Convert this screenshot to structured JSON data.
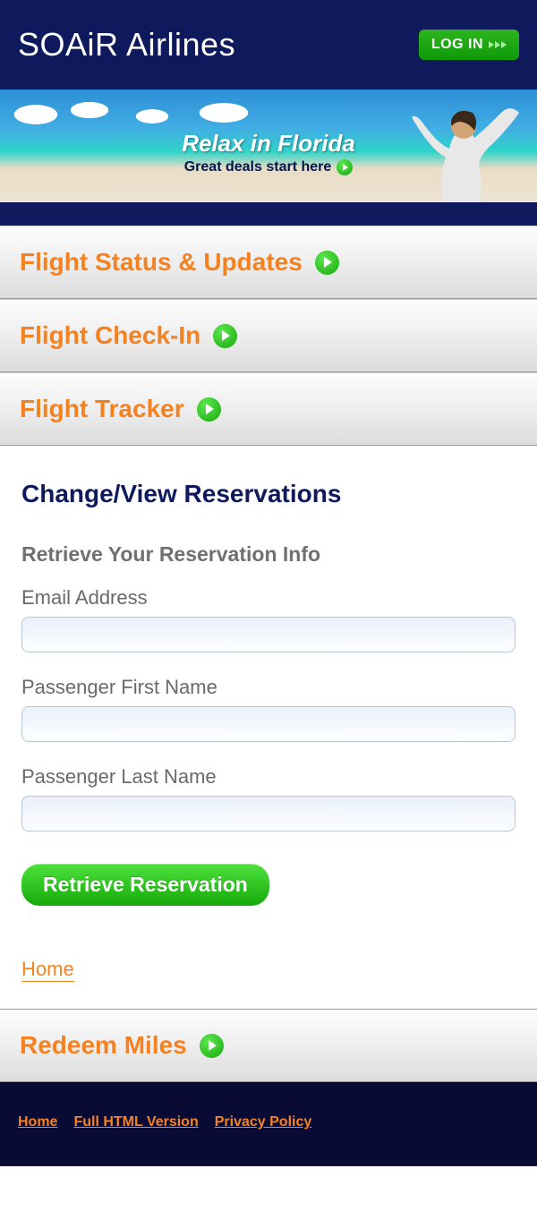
{
  "header": {
    "logo": "SOAiR Airlines",
    "login_label": "LOG IN"
  },
  "hero": {
    "title": "Relax in Florida",
    "subtitle": "Great deals start here"
  },
  "menu": {
    "items": [
      {
        "label": "Flight Status & Updates"
      },
      {
        "label": "Flight Check-In"
      },
      {
        "label": "Flight Tracker"
      }
    ]
  },
  "reservations": {
    "title": "Change/View Reservations",
    "subtitle": "Retrieve Your Reservation Info",
    "email_label": "Email Address",
    "email_value": "",
    "first_label": "Passenger First Name",
    "first_value": "",
    "last_label": "Passenger Last Name",
    "last_value": "",
    "button_label": "Retrieve Reservation"
  },
  "links": {
    "home": "Home"
  },
  "redeem": {
    "label": "Redeem Miles"
  },
  "footer": {
    "home": "Home",
    "full_html": "Full HTML Version",
    "privacy": "Privacy Policy"
  },
  "colors": {
    "brand_dark": "#0f1a5c",
    "accent_orange": "#f58220",
    "button_green": "#18a80e"
  }
}
